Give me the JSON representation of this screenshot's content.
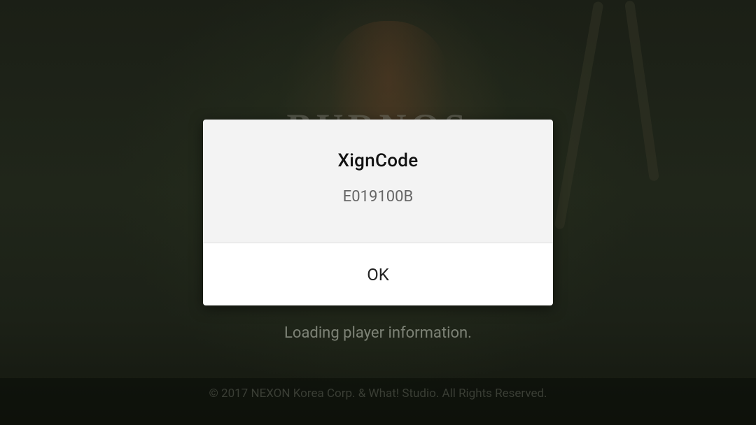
{
  "background": {
    "logo_text": "BURNOS",
    "loading_text": "Loading player information.",
    "copyright": "© 2017 NEXON Korea Corp. & What! Studio. All Rights Reserved."
  },
  "dialog": {
    "title": "XignCode",
    "message": "E019100B",
    "ok_label": "OK"
  },
  "colors": {
    "dialog_body_bg": "#f3f3f3",
    "dialog_actions_bg": "#ffffff",
    "background_dim": "#1c2117"
  }
}
